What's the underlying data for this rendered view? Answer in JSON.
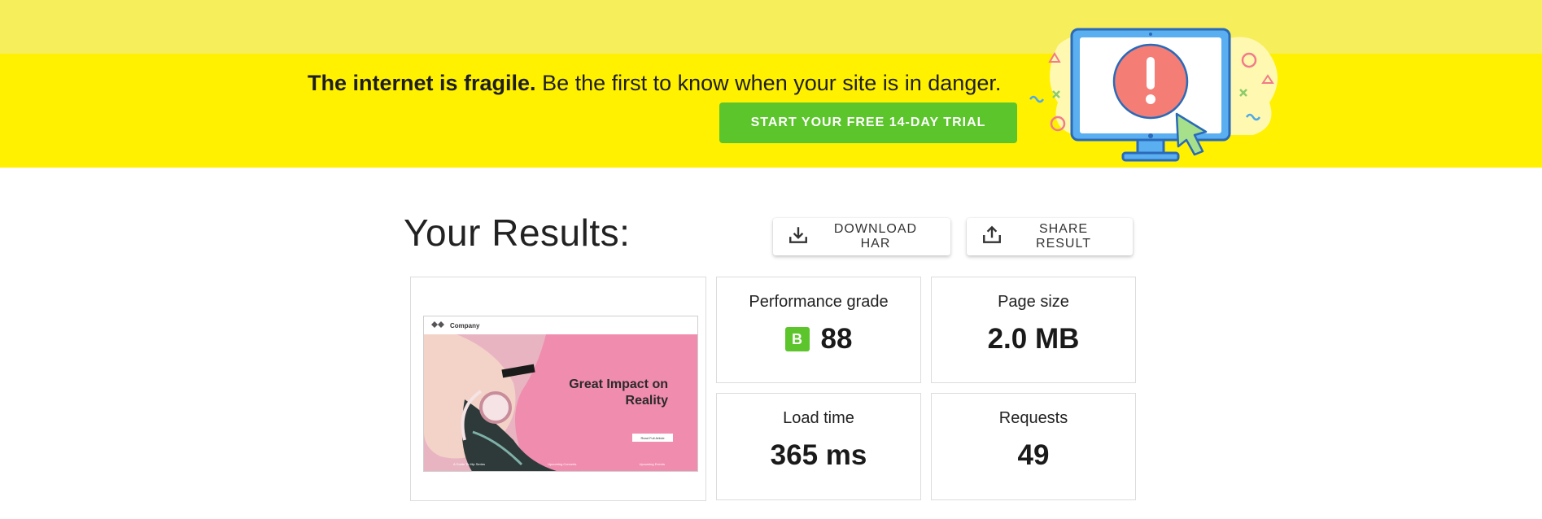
{
  "banner": {
    "headline_bold": "The internet is fragile.",
    "headline_rest": " Be the first to know when your site is in danger.",
    "trial_button": "START YOUR FREE 14-DAY TRIAL",
    "illustration_icon": "monitor-alert-icon"
  },
  "results": {
    "title": "Your Results:",
    "download_button": "DOWNLOAD HAR",
    "download_icon": "download-icon",
    "share_button": "SHARE RESULT",
    "share_icon": "share-icon"
  },
  "screenshot": {
    "logo_text": "Company",
    "headline": "Great Impact on Reality",
    "cta": "Read Full Article",
    "footer_links": [
      "A Guide To Hip Series",
      "Upcoming Concerts",
      "Upcoming Events"
    ]
  },
  "metrics": {
    "performance": {
      "label": "Performance grade",
      "grade": "B",
      "value": "88"
    },
    "page_size": {
      "label": "Page size",
      "value": "2.0 MB"
    },
    "load_time": {
      "label": "Load time",
      "value": "365 ms"
    },
    "requests": {
      "label": "Requests",
      "value": "49"
    }
  },
  "colors": {
    "banner_yellow": "#fff100",
    "top_strip": "#f6ee5a",
    "accent_green": "#5bc52b",
    "hero_pink": "#f08cae"
  }
}
